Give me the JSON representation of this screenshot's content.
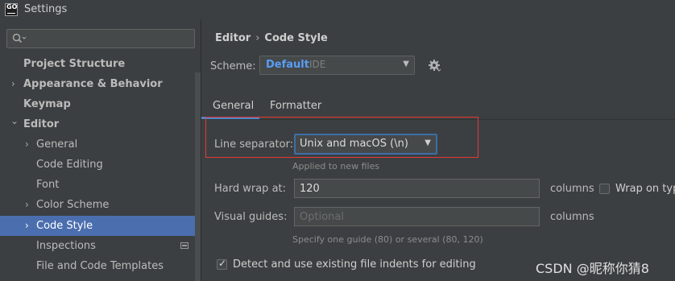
{
  "window": {
    "title": "Settings",
    "app_icon_text": "GO"
  },
  "search": {
    "placeholder": ""
  },
  "tree": [
    {
      "label": "Project Structure",
      "bold": true,
      "arrow": ""
    },
    {
      "label": "Appearance & Behavior",
      "bold": true,
      "arrow": "›"
    },
    {
      "label": "Keymap",
      "bold": true,
      "arrow": ""
    },
    {
      "label": "Editor",
      "bold": true,
      "arrow": "⌄"
    },
    {
      "label": "General",
      "bold": false,
      "arrow": "›"
    },
    {
      "label": "Code Editing",
      "bold": false,
      "arrow": ""
    },
    {
      "label": "Font",
      "bold": false,
      "arrow": ""
    },
    {
      "label": "Color Scheme",
      "bold": false,
      "arrow": "›"
    },
    {
      "label": "Code Style",
      "bold": false,
      "arrow": "›",
      "selected": true
    },
    {
      "label": "Inspections",
      "bold": false,
      "arrow": ""
    },
    {
      "label": "File and Code Templates",
      "bold": false,
      "arrow": ""
    }
  ],
  "breadcrumb": {
    "part1": "Editor",
    "separator": "›",
    "part2": "Code Style"
  },
  "scheme": {
    "label": "Scheme:",
    "name": "Default",
    "sub": "IDE",
    "caret": "▼"
  },
  "tabs": [
    {
      "label": "General",
      "active": true
    },
    {
      "label": "Formatter",
      "active": false
    }
  ],
  "line_separator": {
    "label": "Line separator:",
    "value": "Unix and macOS (\\n)",
    "caret": "▼",
    "note": "Applied to new files"
  },
  "hard_wrap": {
    "label": "Hard wrap at:",
    "value": "120",
    "unit": "columns",
    "wrap_label": "Wrap on typ",
    "wrap_checked": false
  },
  "visual_guides": {
    "label": "Visual guides:",
    "placeholder": "Optional",
    "unit": "columns",
    "note": "Specify one guide (80) or several (80, 120)"
  },
  "detect_indents": {
    "label": "Detect and use existing file indents for editing",
    "checked": true
  },
  "watermark": "CSDN @昵称你猜8",
  "colors": {
    "accent": "#4b6eaf",
    "highlight": "#e53935",
    "scheme_name": "#589df6"
  }
}
